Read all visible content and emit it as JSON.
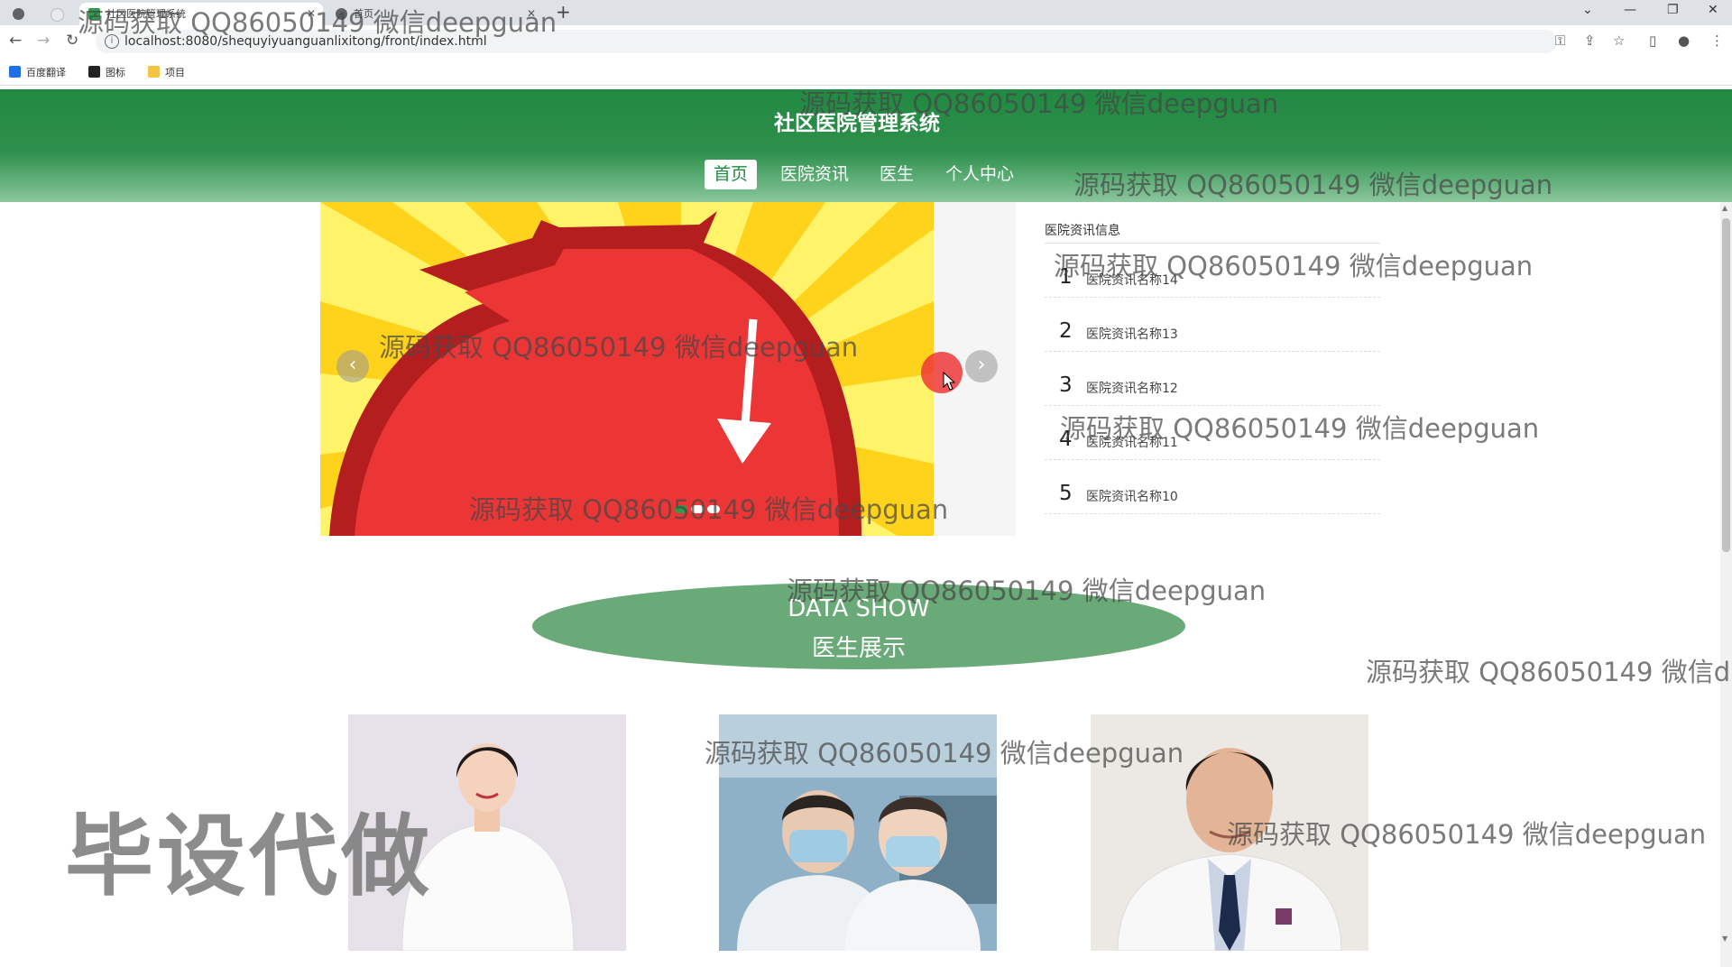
{
  "browser": {
    "tabs": [
      {
        "title": ""
      },
      {
        "title": "社区医院管理系统"
      },
      {
        "title": "首页"
      }
    ],
    "new_tab": "+",
    "url": "localhost:8080/shequyiyuanguanlixitong/front/index.html",
    "bookmarks": [
      {
        "label": "百度翻译",
        "color": "#1f6fe6"
      },
      {
        "label": "图标",
        "color": "#222222"
      },
      {
        "label": "项目",
        "color": "#f5c342"
      }
    ]
  },
  "site": {
    "title": "社区医院管理系统",
    "nav": [
      "首页",
      "医院资讯",
      "医生",
      "个人中心"
    ],
    "brand_color": "#218942"
  },
  "banner": {
    "prev": "‹",
    "next": "›",
    "slide_count": 3,
    "active_slide": 1
  },
  "news": {
    "title": "医院资讯信息",
    "items": [
      {
        "num": "1",
        "name": "医院资讯名称14"
      },
      {
        "num": "2",
        "name": "医院资讯名称13"
      },
      {
        "num": "3",
        "name": "医院资讯名称12"
      },
      {
        "num": "4",
        "name": "医院资讯名称11"
      },
      {
        "num": "5",
        "name": "医院资讯名称10"
      }
    ]
  },
  "data_show": {
    "en": "DATA SHOW",
    "cn": "医生展示"
  },
  "watermarks": {
    "qq": "源码获取 QQ86050149 微信deepguan",
    "qq_cut": "源码获取 QQ86050149 微信d",
    "big": "毕设代做"
  }
}
